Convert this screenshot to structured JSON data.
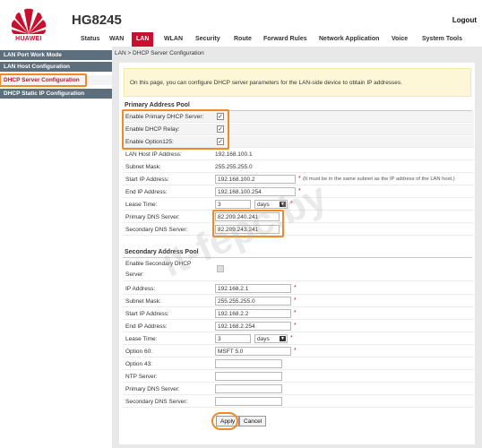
{
  "header": {
    "brand": "HUAWEI",
    "model": "HG8245",
    "logout": "Logout",
    "nav": [
      {
        "label": "Status"
      },
      {
        "label": "WAN"
      },
      {
        "label": "LAN",
        "active": true
      },
      {
        "label": "WLAN"
      },
      {
        "label": "Security"
      },
      {
        "label": "Route"
      },
      {
        "label": "Forward Rules"
      },
      {
        "label": "Network Application"
      },
      {
        "label": "Voice"
      },
      {
        "label": "System Tools"
      }
    ]
  },
  "sidebar": {
    "items": [
      {
        "label": "LAN Port Work Mode"
      },
      {
        "label": "LAN Host Configuration"
      },
      {
        "label": "DHCP Server Configuration",
        "active": true
      },
      {
        "label": "DHCP Static IP Configuration"
      }
    ]
  },
  "breadcrumb": "LAN > DHCP Server Configuration",
  "info_text": "On this page, you can configure DHCP server parameters for the LAN-side device to obtain IP addresses.",
  "primary": {
    "title": "Primary Address Pool",
    "enable_primary_label": "Enable Primary DHCP Server:",
    "enable_primary": true,
    "enable_relay_label": "Enable DHCP Relay:",
    "enable_relay": true,
    "enable_option125_label": "Enable Option125:",
    "enable_option125": true,
    "lan_host_ip_label": "LAN Host IP Address:",
    "lan_host_ip": "192.168.100.1",
    "subnet_label": "Subnet Mask:",
    "subnet": "255.255.255.0",
    "start_ip_label": "Start IP Address:",
    "start_ip": "192.168.100.2",
    "start_ip_hint": "(It must be in the same subnet as the IP address of the LAN host.)",
    "end_ip_label": "End IP Address:",
    "end_ip": "192.168.100.254",
    "lease_label": "Lease Time:",
    "lease_value": "3",
    "lease_unit": "days",
    "dns1_label": "Primary DNS Server:",
    "dns1": "82.209.240.241",
    "dns2_label": "Secondary DNS Server:",
    "dns2": "82.209.243.241"
  },
  "secondary": {
    "title": "Secondary Address Pool",
    "enable_label_1": "Enable Secondary DHCP",
    "enable_label_2": "Server:",
    "enable": false,
    "ip_label": "IP Address:",
    "ip": "192.168.2.1",
    "subnet_label": "Subnet Mask:",
    "subnet": "255.255.255.0",
    "start_ip_label": "Start IP Address:",
    "start_ip": "192.168.2.2",
    "end_ip_label": "End IP Address:",
    "end_ip": "192.168.2.254",
    "lease_label": "Lease Time:",
    "lease_value": "3",
    "lease_unit": "days",
    "option60_label": "Option 60:",
    "option60": "MSFT 5.0",
    "option43_label": "Option 43:",
    "option43": "",
    "ntp_label": "NTP Server:",
    "ntp": "",
    "dns1_label": "Primary DNS Server:",
    "dns1": "",
    "dns2_label": "Secondary DNS Server:",
    "dns2": ""
  },
  "buttons": {
    "apply": "Apply",
    "cancel": "Cancel"
  },
  "required_mark": "*",
  "watermark": "it-fepc.by",
  "colors": {
    "brand_red": "#c8102e",
    "highlight_orange": "#f08a24",
    "sidebar_dark": "#5d6e7c",
    "info_bg": "#fdf7d8"
  }
}
